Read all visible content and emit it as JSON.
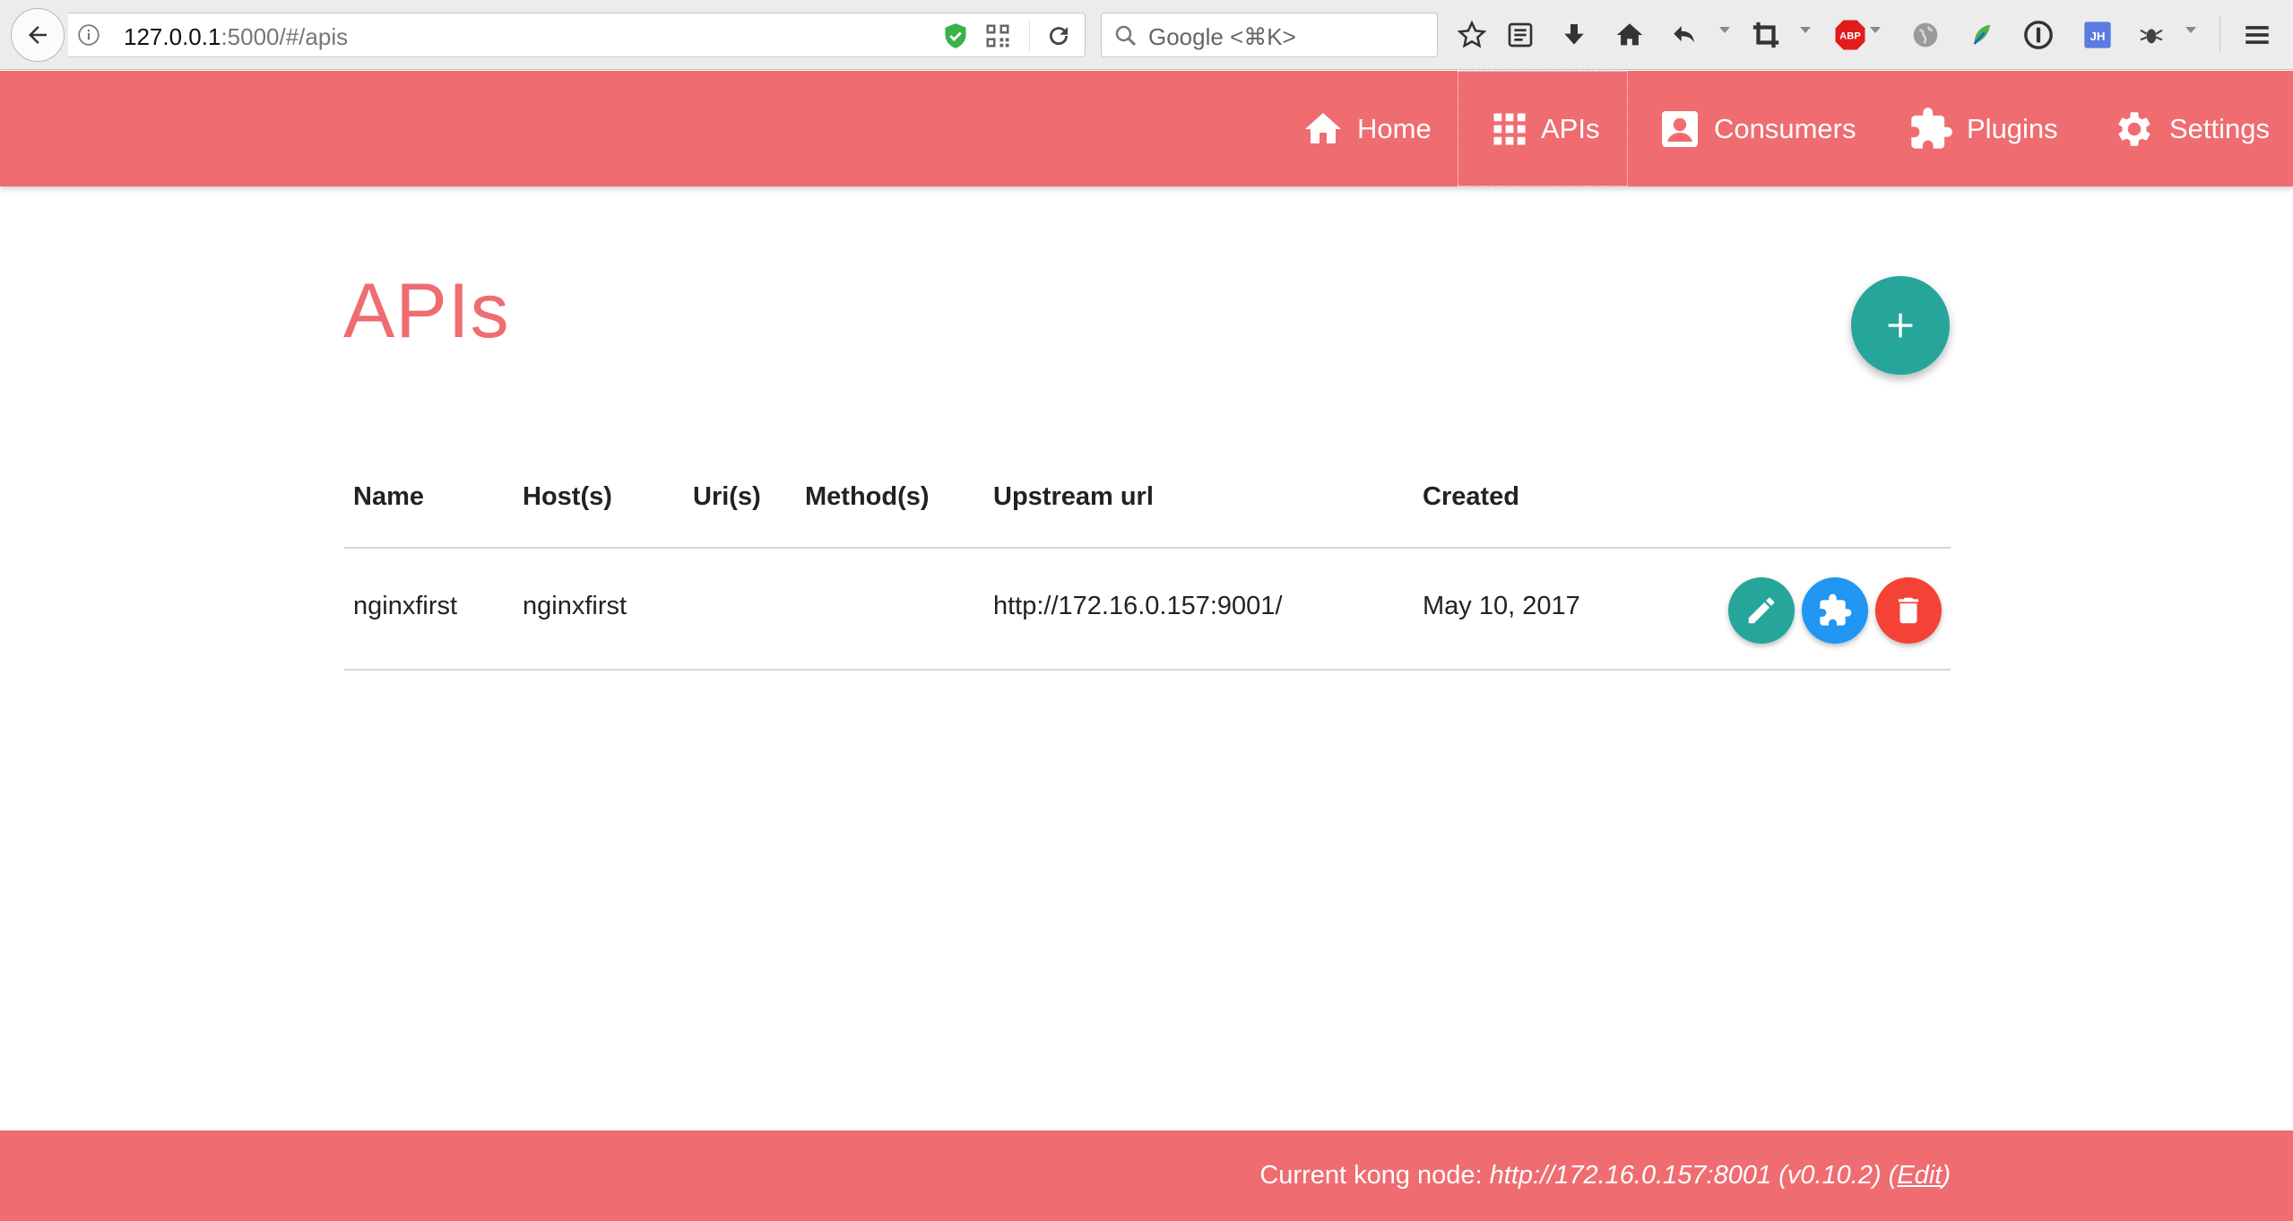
{
  "browser": {
    "url_host": "127.0.0.1",
    "url_rest": ":5000/#/apis",
    "search_placeholder": "Google <⌘K>",
    "toolbar_icons": [
      "star-icon",
      "reader-icon",
      "download-icon",
      "home-icon",
      "undo-icon",
      "crop-icon",
      "adblock-icon",
      "globe-icon",
      "leaf-icon",
      "password-icon",
      "jh-icon",
      "bug-icon",
      "menu-icon"
    ],
    "adblock_label": "ABP",
    "jh_label": "JH"
  },
  "nav": {
    "items": [
      {
        "label": "Home",
        "icon": "home-icon"
      },
      {
        "label": "APIs",
        "icon": "apps-grid-icon",
        "active": true
      },
      {
        "label": "Consumers",
        "icon": "account-box-icon"
      },
      {
        "label": "Plugins",
        "icon": "puzzle-icon"
      },
      {
        "label": "Settings",
        "icon": "gear-icon"
      }
    ]
  },
  "page": {
    "title": "APIs",
    "add_button_label": "+"
  },
  "table": {
    "columns": [
      "Name",
      "Host(s)",
      "Uri(s)",
      "Method(s)",
      "Upstream url",
      "Created"
    ],
    "rows": [
      {
        "name": "nginxfirst",
        "hosts": "nginxfirst",
        "uris": "",
        "methods": "",
        "upstream_url": "http://172.16.0.157:9001/",
        "created": "May 10, 2017",
        "actions": [
          "edit-icon",
          "plugin-icon",
          "delete-icon"
        ]
      }
    ]
  },
  "footer": {
    "prefix": "Current kong node: ",
    "node_url": "http://172.16.0.157:8001",
    "version": " (v0.10.2) (",
    "edit_label": "Edit",
    "suffix": ")"
  },
  "colors": {
    "brand": "#ef6c71",
    "fab": "#26a69a",
    "edit": "#26a69a",
    "plugin": "#2196f3",
    "delete": "#f44336"
  }
}
